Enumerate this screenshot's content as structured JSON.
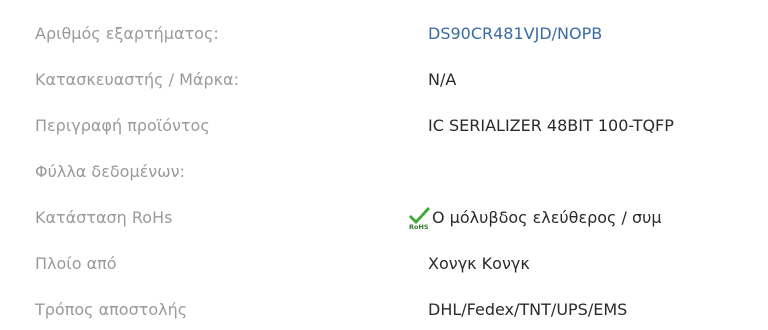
{
  "specs": {
    "part_number": {
      "label": "Αριθμός εξαρτήματος:",
      "value": "DS90CR481VJD/NOPB"
    },
    "manufacturer": {
      "label": "Κατασκευαστής / Μάρκα:",
      "value": "N/A"
    },
    "description": {
      "label": "Περιγραφή προϊόντος",
      "value": "IC SERIALIZER 48BIT 100-TQFP"
    },
    "datasheets": {
      "label": "Φύλλα δεδομένων:",
      "value": ""
    },
    "rohs": {
      "label": "Κατάσταση RoHs",
      "icon": "rohs-compliant-icon",
      "icon_text": "RoHS",
      "value": "Ο μόλυβδος ελεύθερος / συμ"
    },
    "ship_from": {
      "label": "Πλοίο από",
      "value": "Χονγκ Κονγκ"
    },
    "shipping_method": {
      "label": "Τρόπος αποστολής",
      "value": "DHL/Fedex/TNT/UPS/EMS"
    }
  },
  "colors": {
    "label": "#9a9a9a",
    "value": "#2b2b2b",
    "link": "#3a6aa6",
    "rohs_check": "#3aa832",
    "rohs_text": "#2d7a2a"
  }
}
